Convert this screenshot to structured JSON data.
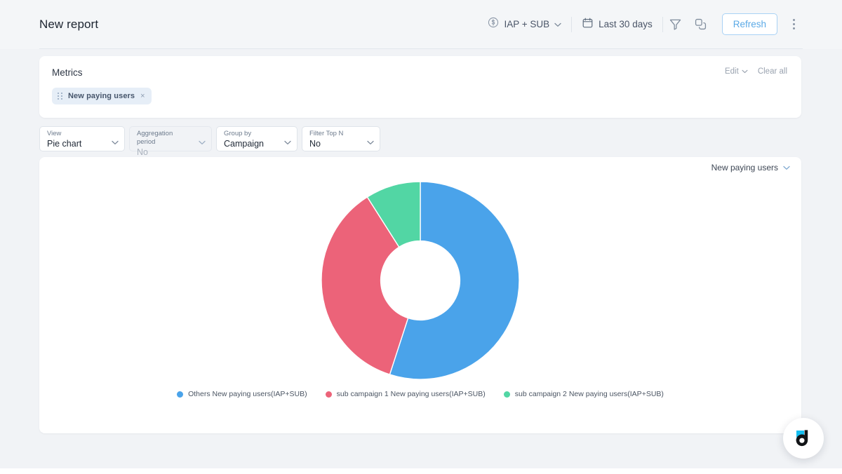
{
  "header": {
    "title": "New report",
    "app_filter": {
      "icon": "dollar-circle-icon",
      "label": "IAP + SUB",
      "chevron": "chevron-down-icon"
    },
    "date_range": {
      "icon": "calendar-icon",
      "label": "Last 30 days"
    },
    "filter_icon": "funnel-icon",
    "compare_icon": "compare-squares-icon",
    "refresh_label": "Refresh",
    "more_icon": "kebab-menu-icon"
  },
  "metrics": {
    "title": "Metrics",
    "edit_label": "Edit",
    "clear_all_label": "Clear all",
    "chips": [
      {
        "label": "New paying users",
        "remove": "×",
        "handle": "drag-handle-icon"
      }
    ]
  },
  "controls": [
    {
      "label": "View",
      "value": "Pie chart",
      "disabled": false,
      "name": "view"
    },
    {
      "label": "Aggregation period",
      "value": "No",
      "disabled": true,
      "name": "aggregation-period"
    },
    {
      "label": "Group by",
      "value": "Campaign",
      "disabled": false,
      "name": "group-by"
    },
    {
      "label": "Filter Top N",
      "value": "No",
      "disabled": false,
      "name": "filter-top-n"
    }
  ],
  "chart_panel": {
    "metric_selector": "New paying users"
  },
  "chart_data": {
    "type": "pie",
    "title": "New paying users",
    "donut": true,
    "inner_radius_ratio": 0.4,
    "start_angle": 0,
    "direction": "clockwise",
    "legend_position": "bottom",
    "categories": [
      "Others New paying users(IAP+SUB)",
      "sub campaign 1 New paying users(IAP+SUB)",
      "sub campaign 2 New paying users(IAP+SUB)"
    ],
    "values": [
      55,
      36,
      9
    ],
    "percentages": [
      55,
      36,
      9
    ],
    "colors": [
      "#4aa3ea",
      "#ec6379",
      "#52d6a4"
    ]
  },
  "fab": {
    "name": "devtodev-logo-fab"
  },
  "colors": {
    "accent_blue": "#5aa9e6",
    "series_blue": "#4aa3ea",
    "series_red": "#ec6379",
    "series_green": "#52d6a4",
    "page_bg": "#f1f3f6"
  }
}
